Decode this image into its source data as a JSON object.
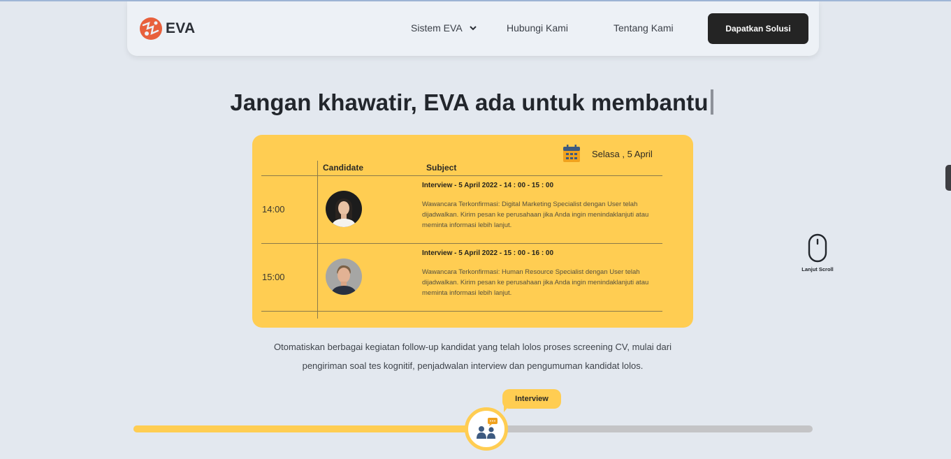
{
  "brand": {
    "name": "EVA",
    "color": "#e8603c"
  },
  "nav": {
    "items": [
      {
        "label": "Sistem EVA",
        "has_dropdown": true
      },
      {
        "label": "Hubungi Kami"
      },
      {
        "label": "Tentang Kami"
      }
    ],
    "cta_label": "Dapatkan Solusi"
  },
  "headline": "Jangan khawatir, EVA ada untuk membantu",
  "schedule": {
    "date": "Selasa , 5 April",
    "columns": {
      "candidate": "Candidate",
      "subject": "Subject"
    },
    "rows": [
      {
        "time": "14:00",
        "title": "Interview - 5 April 2022 - 14 : 00 - 15 : 00",
        "description": "Wawancara Terkonfirmasi: Digital Marketing Specialist dengan User telah dijadwalkan. Kirim pesan ke perusahaan jika Anda ingin menindaklanjuti atau meminta informasi lebih lanjut."
      },
      {
        "time": "15:00",
        "title": "Interview - 5 April 2022 - 15 : 00 - 16 : 00",
        "description": "Wawancara Terkonfirmasi: Human Resource Specialist dengan User telah dijadwalkan. Kirim pesan ke perusahaan jika Anda ingin menindaklanjuti atau meminta informasi lebih lanjut."
      }
    ]
  },
  "description": "Otomatiskan berbagai kegiatan follow-up kandidat yang telah lolos proses screening CV, mulai dari pengiriman soal tes kognitif, penjadwalan interview dan pengumuman kandidat lolos.",
  "scroll_hint": "Lanjut Scroll",
  "progress": {
    "label": "Interview",
    "fraction": 0.52,
    "accent": "#ffcd52",
    "track": "#c4c4c6"
  },
  "colors": {
    "background": "#e3e8ef",
    "card": "#ffcd52",
    "button": "#242424"
  }
}
